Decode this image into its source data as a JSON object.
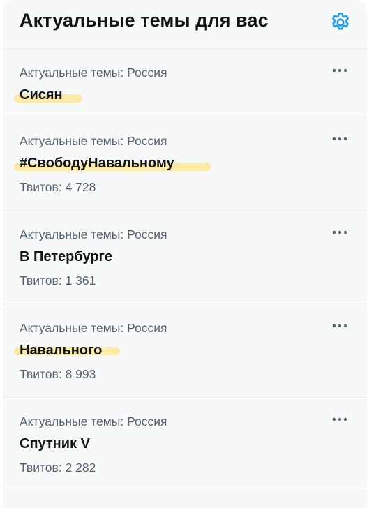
{
  "header": {
    "title": "Актуальные темы для вас",
    "settings_icon": "gear-icon"
  },
  "trends": [
    {
      "context": "Актуальные темы: Россия",
      "name": "Сисян",
      "count": "",
      "highlighted": true
    },
    {
      "context": "Актуальные темы: Россия",
      "name": "#СвободуНавальному",
      "count": "Твитов: 4 728",
      "highlighted": true
    },
    {
      "context": "Актуальные темы: Россия",
      "name": "В Петербурге",
      "count": "Твитов: 1 361",
      "highlighted": false
    },
    {
      "context": "Актуальные темы: Россия",
      "name": "Навального",
      "count": "Твитов: 8 993",
      "highlighted": true
    },
    {
      "context": "Актуальные темы: Россия",
      "name": "Спутник V",
      "count": "Твитов: 2 282",
      "highlighted": false
    }
  ],
  "colors": {
    "accent": "#1d9bf0",
    "text_primary": "#0f1419",
    "text_secondary": "#536471",
    "highlight": "#ffdd64"
  }
}
